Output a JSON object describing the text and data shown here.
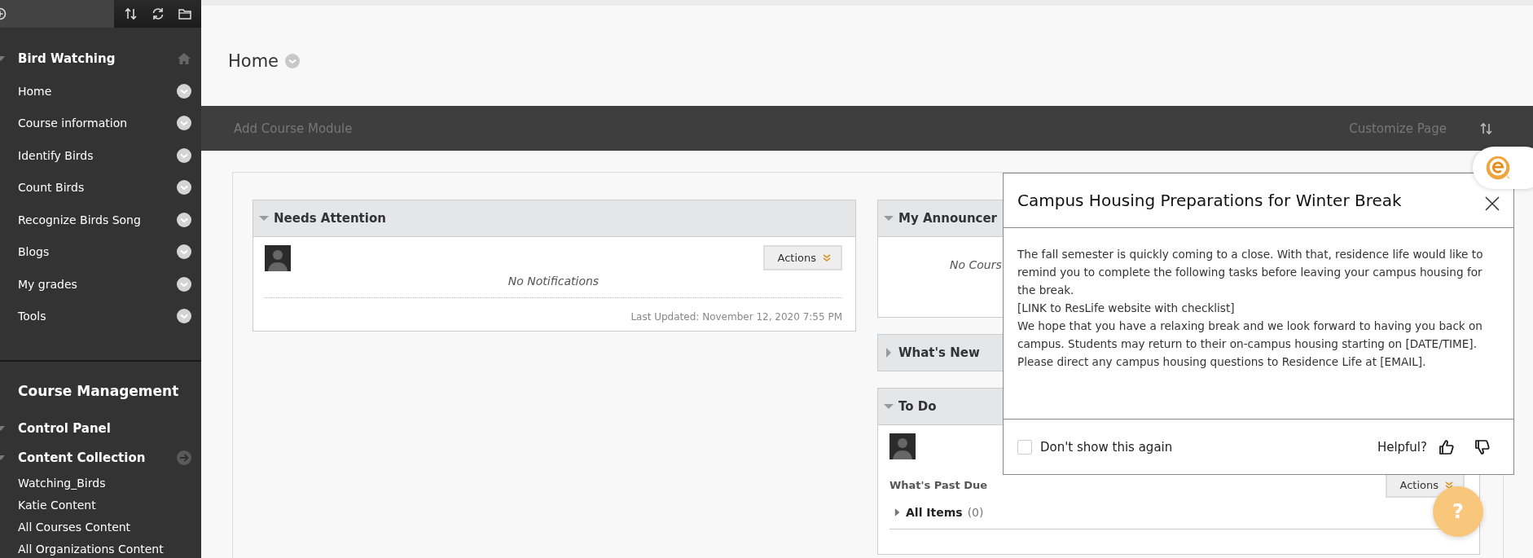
{
  "sidebar": {
    "course": {
      "title": "Bird Watching",
      "expanded": true
    },
    "menu": [
      {
        "label": "Home"
      },
      {
        "label": "Course information"
      },
      {
        "label": "Identify Birds"
      },
      {
        "label": "Count Birds"
      },
      {
        "label": "Recognize Birds Song"
      },
      {
        "label": "Blogs"
      },
      {
        "label": "My grades"
      },
      {
        "label": "Tools"
      }
    ],
    "management": {
      "title": "Course Management",
      "sections": [
        {
          "label": "Control Panel",
          "expanded": true,
          "kind": "plain"
        },
        {
          "label": "Content Collection",
          "expanded": true,
          "kind": "link"
        }
      ],
      "links": [
        {
          "label": "Watching_Birds"
        },
        {
          "label": "Katie Content"
        },
        {
          "label": "All Courses Content"
        },
        {
          "label": "All Organizations Content"
        }
      ]
    }
  },
  "page": {
    "title": "Home"
  },
  "toolbar": {
    "add_module": "Add Course Module",
    "customize": "Customize Page"
  },
  "modules": {
    "left": [
      {
        "kind": "notifications",
        "title": "Needs Attention",
        "expanded": true,
        "actions": "Actions",
        "empty": "No Notifications",
        "updated": "Last Updated: November 12, 2020 7:55 PM"
      }
    ],
    "right": [
      {
        "kind": "announcements",
        "title": "My Announcer",
        "expanded": true,
        "empty": "No Cours"
      },
      {
        "kind": "collapsed",
        "title": "What's New",
        "expanded": false
      },
      {
        "kind": "todo",
        "title": "To Do",
        "expanded": true,
        "section": "What's Past Due",
        "actions": "Actions",
        "items": [
          {
            "label": "All Items",
            "count": "(0)",
            "expanded": false
          }
        ]
      }
    ]
  },
  "popup": {
    "title": "Campus Housing Preparations for Winter Break",
    "paragraphs": [
      "The fall semester is quickly coming to a close. With that, residence life would like to remind you to complete the following tasks before leaving your campus housing for the break.",
      "[LINK to ResLife website with checklist]",
      "We hope that you have a relaxing break and we look forward to having you back on campus. Students may return to their on-campus housing starting on [DATE/TIME].",
      "Please direct any campus housing questions to Residence Life at [EMAIL]."
    ],
    "dont_show": {
      "label": "Don't show this again",
      "checked": false
    },
    "helpful": "Helpful?"
  },
  "help_button": {
    "label": "?"
  }
}
